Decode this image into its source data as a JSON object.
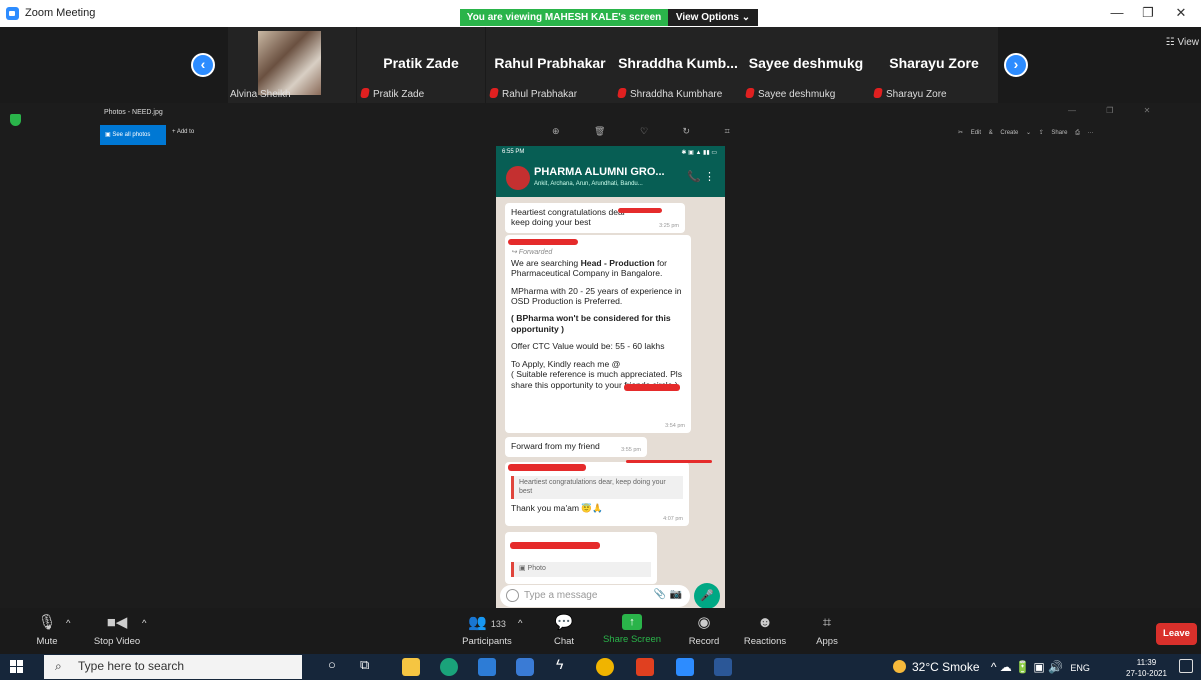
{
  "window": {
    "title": "Zoom Meeting",
    "viewing_banner": "You are viewing MAHESH KALE's screen",
    "view_options": "View Options ⌄",
    "minimize": "—",
    "restore": "❐",
    "close": "✕"
  },
  "strip": {
    "view_label": "View",
    "participants": [
      {
        "label": "Alvina Sheikh"
      },
      {
        "name": "Pratik Zade",
        "label": "Pratik Zade"
      },
      {
        "name": "Rahul Prabhakar",
        "label": "Rahul Prabhakar"
      },
      {
        "name": "Shraddha  Kumb...",
        "label": "Shraddha Kumbhare"
      },
      {
        "name": "Sayee deshmukg",
        "label": "Sayee deshmukg"
      },
      {
        "name": "Sharayu Zore",
        "label": "Sharayu Zore"
      }
    ]
  },
  "photos_app": {
    "title": "Photos - NEED.jpg",
    "see_all": "See all photos",
    "add_to": "+ Add to",
    "tools": "⊕ 🗑 ♡ ↻ ⌗",
    "edit_create": "✂ Edit & Create  ⌄   ⇪ Share   ⎙   ···",
    "window_controls": "— ❐ ✕"
  },
  "phone": {
    "time": "6:55 PM",
    "status_icons": "✱ ▣ ▲ ▮▮ ▭",
    "group_name": "PHARMA ALUMNI GRO...",
    "members": "Ankit, Archana, Arun, Arundhati, Bandu...",
    "header_icons": "📞 ⋮",
    "messages": [
      {
        "text": "Heartiest congratulations dear",
        "text2": "keep doing your best",
        "time": "3:25 pm"
      },
      {
        "forwarded": "↪ Forwarded",
        "p1a": "We are searching ",
        "p1b": "Head - Production",
        "p1c": " for Pharmaceutical Company in Bangalore.",
        "p2": "MPharma with 20 - 25 years of experience in OSD Production is Preferred.",
        "p3": "( BPharma won't be considered for this opportunity )",
        "p4": "Offer CTC Value would be: 55 - 60 lakhs",
        "p5a": "To Apply, Kindly reach me @",
        "p5b": "( Suitable reference is much appreciated. Pls share this opportunity to your friends circle )",
        "time": "3:54 pm"
      },
      {
        "text": "Forward from my friend",
        "time": "3:55 pm"
      },
      {
        "quote": "Heartiest congratulations dear",
        "quote2": ", keep doing your best",
        "text": "Thank you ma'am 😇🙏",
        "time": "4:07 pm"
      },
      {
        "photo_label": "▣ Photo"
      }
    ],
    "input_placeholder": "Type a message",
    "attach_icon": "📎",
    "camera_icon": "📷",
    "mic_icon": "🎤"
  },
  "controls": {
    "mute": "Mute",
    "stop_video": "Stop Video",
    "participants": "Participants",
    "participants_count": "133",
    "chat": "Chat",
    "share_screen": "Share Screen",
    "record": "Record",
    "reactions": "Reactions",
    "apps": "Apps",
    "leave": "Leave"
  },
  "taskbar": {
    "search_placeholder": "Type here to search",
    "weather": "32°C  Smoke",
    "tray_icons": "^ ☁ 🔋 ▣ 🔊",
    "lang": "ENG",
    "time": "11:39",
    "date": "27-10-2021"
  },
  "colors": {
    "zoom_blue": "#2d8cff",
    "share_green": "#2ab44a",
    "leave_red": "#d9302b",
    "whatsapp_teal": "#075e54",
    "taskbar": "#16263a"
  }
}
